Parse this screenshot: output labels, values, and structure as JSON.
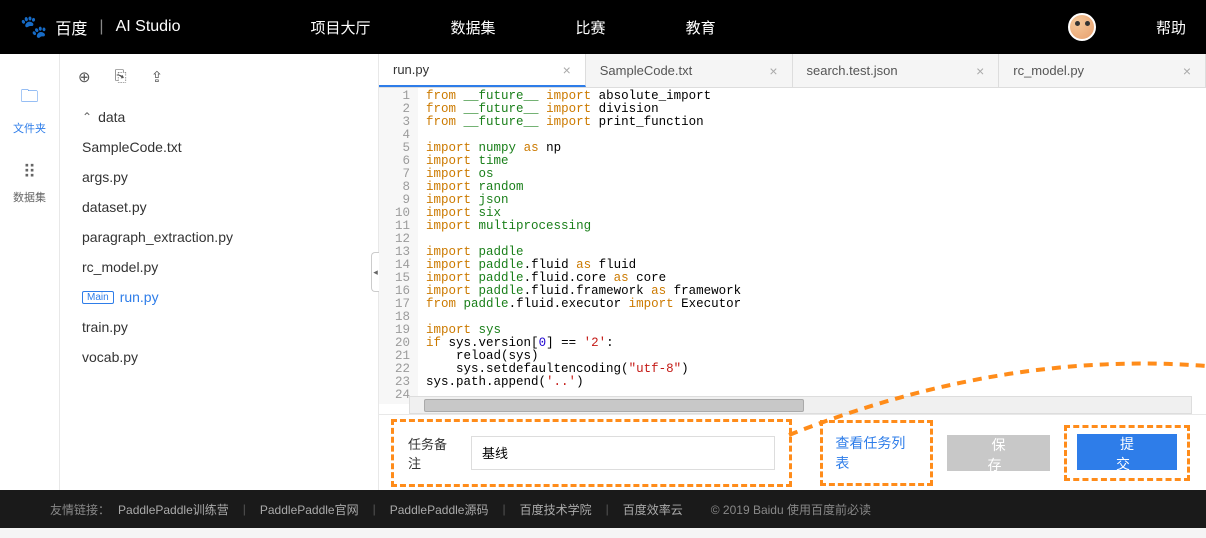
{
  "header": {
    "brand_cn": "百度",
    "brand_studio": "AI Studio",
    "nav": [
      "项目大厅",
      "数据集",
      "比赛",
      "教育"
    ],
    "help": "帮助"
  },
  "rail": {
    "files": "文件夹",
    "datasets": "数据集"
  },
  "filetree": {
    "folder": "data",
    "files": [
      "SampleCode.txt",
      "args.py",
      "dataset.py",
      "paragraph_extraction.py",
      "rc_model.py"
    ],
    "main_tag": "Main",
    "main_file": "run.py",
    "files_after": [
      "train.py",
      "vocab.py"
    ]
  },
  "tabs": [
    {
      "label": "run.py",
      "active": true
    },
    {
      "label": "SampleCode.txt",
      "active": false
    },
    {
      "label": "search.test.json",
      "active": false
    },
    {
      "label": "rc_model.py",
      "active": false
    }
  ],
  "code": [
    {
      "n": 1,
      "t": "from",
      "m": "__future__",
      "i": "import",
      "r": "absolute_import"
    },
    {
      "n": 2,
      "t": "from",
      "m": "__future__",
      "i": "import",
      "r": "division"
    },
    {
      "n": 3,
      "t": "from",
      "m": "__future__",
      "i": "import",
      "r": "print_function"
    },
    {
      "n": 4,
      "raw": ""
    },
    {
      "n": 5,
      "t": "import",
      "m": "numpy",
      "a": "as",
      "al": "np"
    },
    {
      "n": 6,
      "t": "import",
      "m": "time"
    },
    {
      "n": 7,
      "t": "import",
      "m": "os"
    },
    {
      "n": 8,
      "t": "import",
      "m": "random"
    },
    {
      "n": 9,
      "t": "import",
      "m": "json"
    },
    {
      "n": 10,
      "t": "import",
      "m": "six"
    },
    {
      "n": 11,
      "t": "import",
      "m": "multiprocessing"
    },
    {
      "n": 12,
      "raw": ""
    },
    {
      "n": 13,
      "t": "import",
      "m": "paddle"
    },
    {
      "n": 14,
      "t": "import",
      "mp": "paddle.fluid",
      "a": "as",
      "al": "fluid"
    },
    {
      "n": 15,
      "t": "import",
      "mp": "paddle.fluid.core",
      "a": "as",
      "al": "core"
    },
    {
      "n": 16,
      "t": "import",
      "mp": "paddle.fluid.framework",
      "a": "as",
      "al": "framework"
    },
    {
      "n": 17,
      "t": "from",
      "mp": "paddle.fluid.executor",
      "i": "import",
      "r": "Executor"
    },
    {
      "n": 18,
      "raw": ""
    },
    {
      "n": 19,
      "t": "import",
      "m": "sys"
    },
    {
      "n": 20,
      "ifline": true
    },
    {
      "n": 21,
      "reload": true
    },
    {
      "n": 22,
      "setenc": true
    },
    {
      "n": 23,
      "pathline": true
    },
    {
      "n": 24,
      "raw": ""
    }
  ],
  "bottom": {
    "remark_label": "任务备注",
    "remark_value": "基线",
    "view_tasks": "查看任务列表",
    "save": "保存",
    "submit": "提交"
  },
  "footer": {
    "label": "友情链接：",
    "links": [
      "PaddlePaddle训练营",
      "PaddlePaddle官网",
      "PaddlePaddle源码",
      "百度技术学院",
      "百度效率云"
    ],
    "copyright": "© 2019 Baidu 使用百度前必读"
  }
}
